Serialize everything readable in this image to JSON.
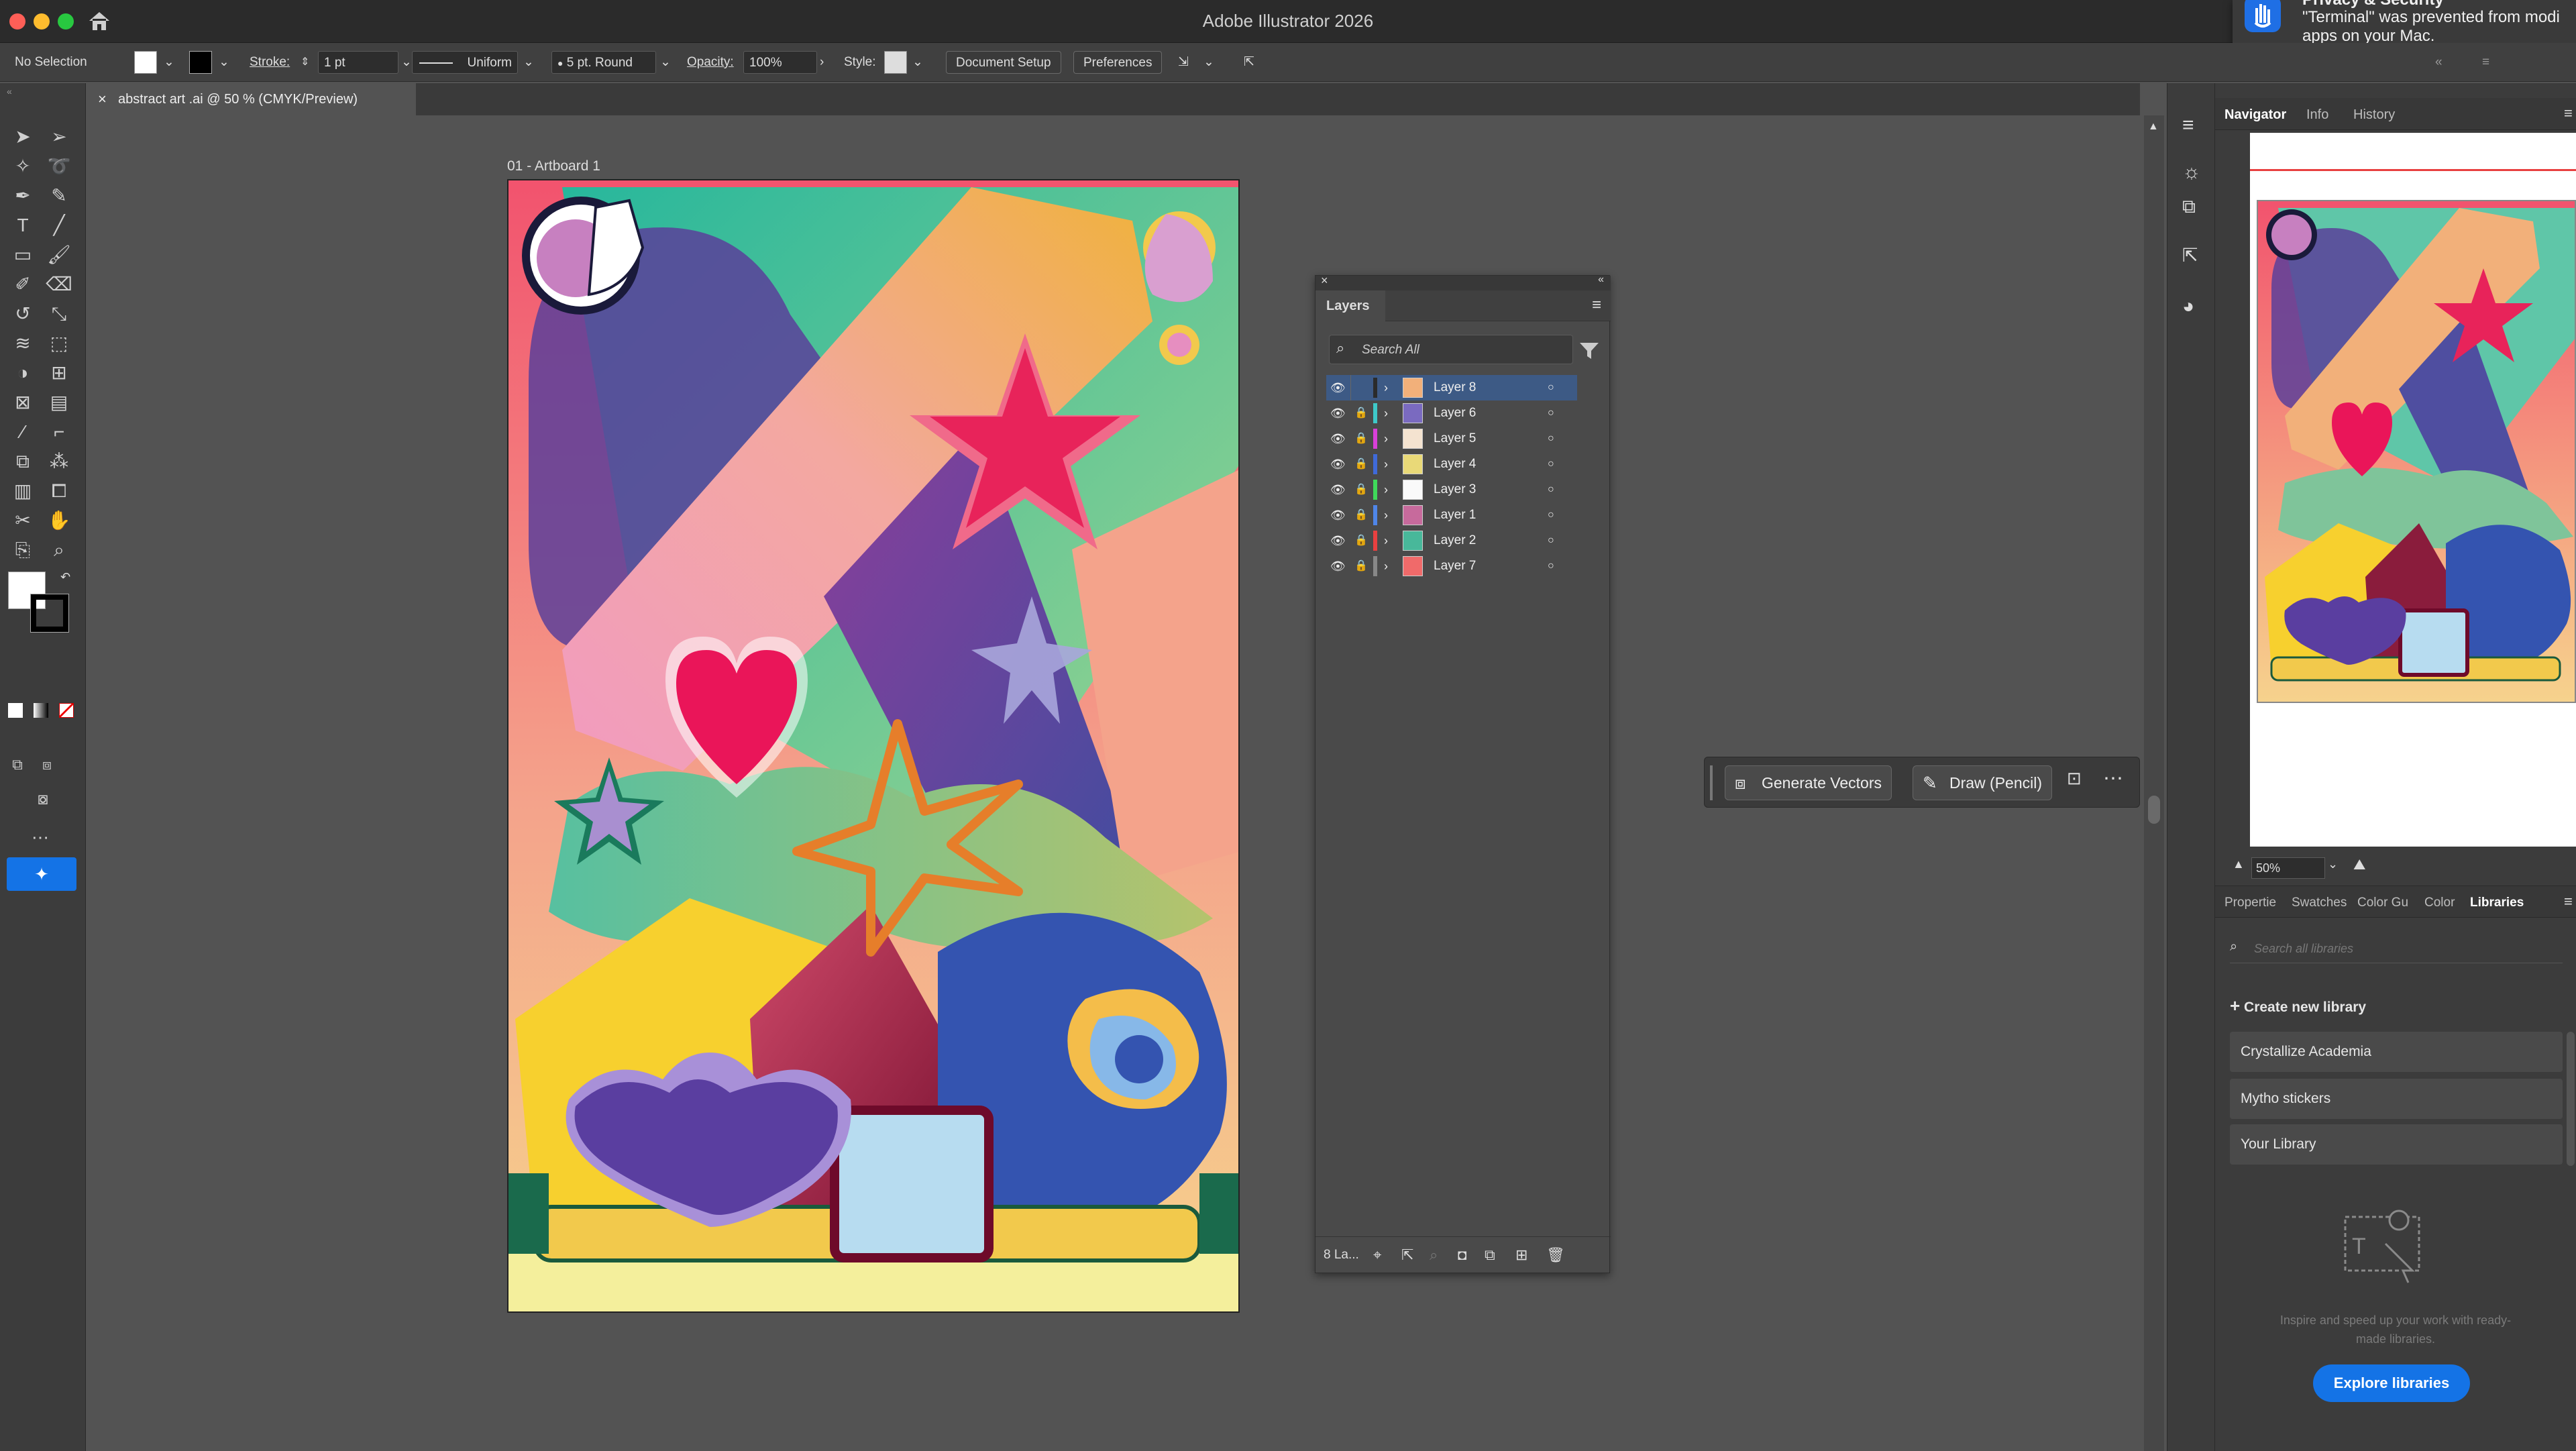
{
  "app": {
    "title": "Adobe Illustrator 2026"
  },
  "notification": {
    "title": "Privacy & Security",
    "text_line1": "\"Terminal\" was prevented from modi",
    "text_line2": "apps on your Mac."
  },
  "controlbar": {
    "selection": "No Selection",
    "stroke_label": "Stroke:",
    "stroke_value": "1 pt",
    "profile": "Uniform",
    "brush": "5 pt. Round",
    "opacity_label": "Opacity:",
    "opacity_value": "100%",
    "style_label": "Style:",
    "doc_setup": "Document Setup",
    "preferences": "Preferences"
  },
  "tab": {
    "label": "abstract art .ai @ 50 % (CMYK/Preview)"
  },
  "artboard": {
    "label": "01 - Artboard 1"
  },
  "layers_panel": {
    "title": "Layers",
    "search_placeholder": "Search All",
    "footer_count": "8 La...",
    "layers": [
      {
        "name": "Layer 8",
        "color": "#2b2b2b",
        "selected": true
      },
      {
        "name": "Layer 6",
        "color": "#3ec9c9"
      },
      {
        "name": "Layer 5",
        "color": "#d93fd9"
      },
      {
        "name": "Layer 4",
        "color": "#3f6ad9"
      },
      {
        "name": "Layer 3",
        "color": "#3fd95a"
      },
      {
        "name": "Layer 1",
        "color": "#4f86e8"
      },
      {
        "name": "Layer 2",
        "color": "#e84040"
      },
      {
        "name": "Layer 7",
        "color": "#888888"
      }
    ]
  },
  "contextbar": {
    "generate": "Generate Vectors",
    "draw": "Draw (Pencil)"
  },
  "navigator": {
    "tabs": [
      "Navigator",
      "Info",
      "History"
    ],
    "zoom": "50%"
  },
  "libraries": {
    "tabs": [
      "Propertie",
      "Swatches",
      "Color Gu",
      "Color",
      "Libraries"
    ],
    "search_placeholder": "Search all libraries",
    "create": "Create new library",
    "items": [
      "Crystallize Academia",
      "Mytho stickers",
      "Your Library"
    ],
    "empty_text_1": "Inspire and speed up your work with ready-",
    "empty_text_2": "made libraries.",
    "explore": "Explore libraries"
  }
}
